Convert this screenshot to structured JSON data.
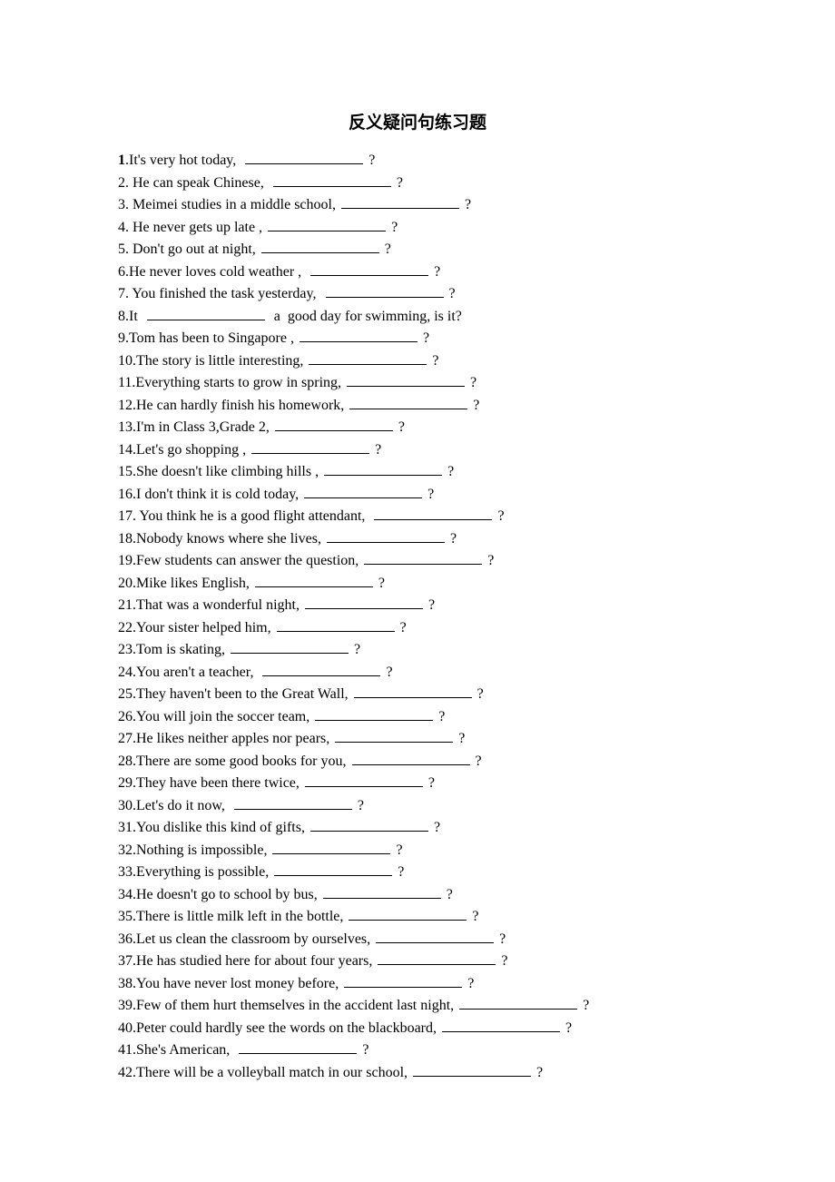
{
  "title": "反义疑问句练习题",
  "questions": [
    {
      "num": "1",
      "prefix": "It's very hot today,  ",
      "suffix": " ?",
      "bold_num": true
    },
    {
      "num": "2",
      "prefix": " He can speak Chinese,  ",
      "suffix": " ?"
    },
    {
      "num": "3",
      "prefix": " Meimei studies in a middle school, ",
      "suffix": " ?"
    },
    {
      "num": "4",
      "prefix": " He never gets up late , ",
      "suffix": " ?"
    },
    {
      "num": "5",
      "prefix": " Don't go out at night, ",
      "suffix": " ?"
    },
    {
      "num": "6",
      "prefix": "He never loves cold weather ,  ",
      "suffix": " ?"
    },
    {
      "num": "7",
      "prefix": " You finished the task yesterday,  ",
      "suffix": " ?"
    },
    {
      "num": "8",
      "prefix": "It  ",
      "suffix": "  a  good day for swimming, is it?",
      "no_trailing_q": true
    },
    {
      "num": "9",
      "prefix": "Tom has been to Singapore , ",
      "suffix": " ?"
    },
    {
      "num": "10",
      "prefix": "The story is little interesting, ",
      "suffix": " ?"
    },
    {
      "num": "11",
      "prefix": "Everything starts to grow in spring, ",
      "suffix": " ?"
    },
    {
      "num": "12",
      "prefix": "He can hardly finish his homework, ",
      "suffix": " ?"
    },
    {
      "num": "13",
      "prefix": "I'm in Class 3,Grade 2, ",
      "suffix": " ?"
    },
    {
      "num": "14",
      "prefix": "Let's go shopping , ",
      "suffix": " ?"
    },
    {
      "num": "15",
      "prefix": "She doesn't like climbing hills , ",
      "suffix": " ?"
    },
    {
      "num": "16",
      "prefix": "I don't think it is cold today, ",
      "suffix": " ?"
    },
    {
      "num": "17",
      "prefix": " You think he is a good flight attendant,  ",
      "suffix": " ?"
    },
    {
      "num": "18",
      "prefix": "Nobody knows where she lives, ",
      "suffix": " ?"
    },
    {
      "num": "19",
      "prefix": "Few students can answer the question, ",
      "suffix": " ?"
    },
    {
      "num": "20",
      "prefix": "Mike likes English, ",
      "suffix": " ?"
    },
    {
      "num": "21",
      "prefix": "That was a wonderful night, ",
      "suffix": " ?"
    },
    {
      "num": "22",
      "prefix": "Your sister helped him, ",
      "suffix": " ?"
    },
    {
      "num": "23",
      "prefix": "Tom is skating, ",
      "suffix": " ?"
    },
    {
      "num": "24",
      "prefix": "You aren't a teacher,  ",
      "suffix": " ?"
    },
    {
      "num": "25",
      "prefix": "They haven't been to the Great Wall, ",
      "suffix": " ?"
    },
    {
      "num": "26",
      "prefix": "You will join the soccer team, ",
      "suffix": " ?"
    },
    {
      "num": "27",
      "prefix": "He likes neither apples nor pears, ",
      "suffix": " ?"
    },
    {
      "num": "28",
      "prefix": "There are some good books for you, ",
      "suffix": " ?"
    },
    {
      "num": "29",
      "prefix": "They have been there twice, ",
      "suffix": " ?"
    },
    {
      "num": "30",
      "prefix": "Let's do it now,  ",
      "suffix": " ?"
    },
    {
      "num": "31",
      "prefix": "You dislike this kind of gifts, ",
      "suffix": " ?"
    },
    {
      "num": "32",
      "prefix": "Nothing is impossible, ",
      "suffix": " ?"
    },
    {
      "num": "33",
      "prefix": "Everything is possible, ",
      "suffix": " ?"
    },
    {
      "num": "34",
      "prefix": "He doesn't go to school by bus, ",
      "suffix": " ?"
    },
    {
      "num": "35",
      "prefix": "There is little milk left in the bottle, ",
      "suffix": " ?"
    },
    {
      "num": "36",
      "prefix": "Let us clean the classroom by ourselves, ",
      "suffix": " ?"
    },
    {
      "num": "37",
      "prefix": "He has studied here for about four years, ",
      "suffix": " ?"
    },
    {
      "num": "38",
      "prefix": "You have never lost money before, ",
      "suffix": " ?"
    },
    {
      "num": "39",
      "prefix": "Few of them hurt themselves in the accident last night, ",
      "suffix": " ?"
    },
    {
      "num": "40",
      "prefix": "Peter could hardly see the words on the blackboard, ",
      "suffix": " ?"
    },
    {
      "num": "41",
      "prefix": "She's American,  ",
      "suffix": " ?"
    },
    {
      "num": "42",
      "prefix": "There will be a volleyball match in our school, ",
      "suffix": " ?"
    }
  ]
}
